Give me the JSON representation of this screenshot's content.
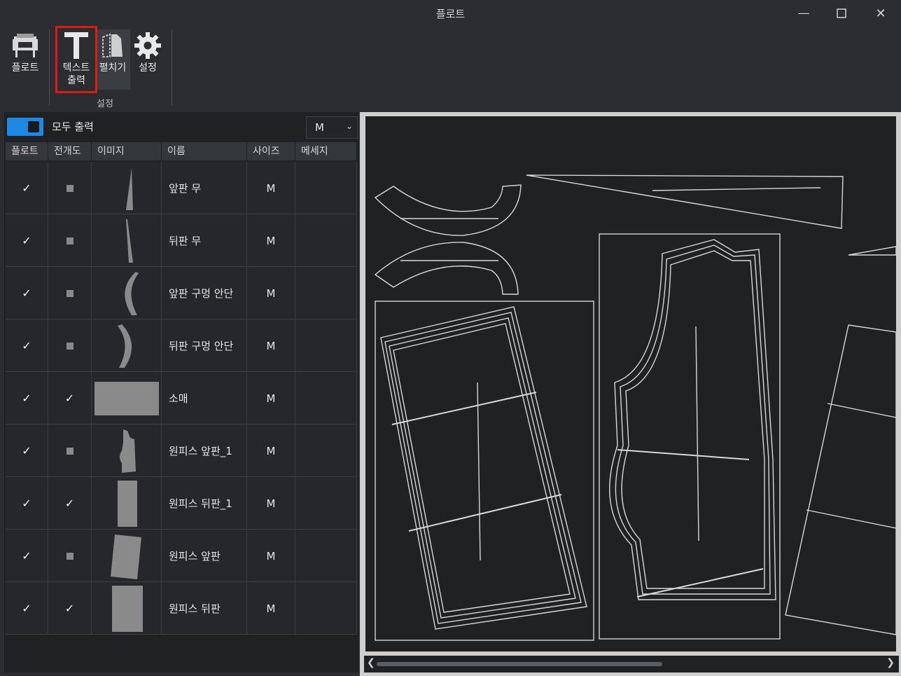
{
  "window": {
    "title": "플로트"
  },
  "toolbar": {
    "plot_label": "플로트",
    "text_output_label": "텍스트\n출력",
    "unfold_label": "펼치기",
    "settings_label": "설정",
    "group_caption": "설정"
  },
  "controls": {
    "print_all_label": "모두 출력",
    "size_selected": "M"
  },
  "table": {
    "headers": [
      "플로트",
      "전개도",
      "이미지",
      "이름",
      "사이즈",
      "메세지"
    ],
    "rows": [
      {
        "name": "앞판 무",
        "size": "M",
        "plot": true,
        "unfold": false,
        "shape": "sliver-up"
      },
      {
        "name": "뒤판 무",
        "size": "M",
        "plot": true,
        "unfold": false,
        "shape": "sliver-down"
      },
      {
        "name": "앞판 구멍 안단",
        "size": "M",
        "plot": true,
        "unfold": false,
        "shape": "arc-left"
      },
      {
        "name": "뒤판 구멍 안단",
        "size": "M",
        "plot": true,
        "unfold": false,
        "shape": "arc-right"
      },
      {
        "name": "소매",
        "size": "M",
        "plot": true,
        "unfold": true,
        "shape": "wide-rect"
      },
      {
        "name": "원피스 앞판_1",
        "size": "M",
        "plot": true,
        "unfold": false,
        "shape": "bodice"
      },
      {
        "name": "원피스 뒤판_1",
        "size": "M",
        "plot": true,
        "unfold": true,
        "shape": "tall-rect"
      },
      {
        "name": "원피스 앞판",
        "size": "M",
        "plot": true,
        "unfold": false,
        "shape": "tilted-rect"
      },
      {
        "name": "원피스 뒤판",
        "size": "M",
        "plot": true,
        "unfold": true,
        "shape": "tall-rect-wide"
      }
    ]
  },
  "colors": {
    "accent": "#1e88e5",
    "highlight": "#e01818",
    "thumb": "#8a8a8a"
  }
}
